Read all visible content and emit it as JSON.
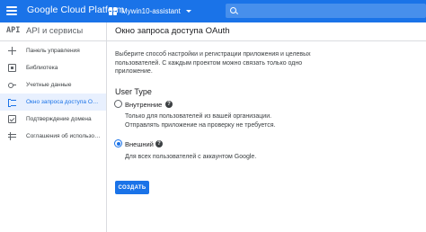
{
  "topbar": {
    "brand": "Google Cloud Platform",
    "project": "Mywin10-assistant",
    "accent_color": "#1a73e8"
  },
  "header": {
    "api_logo": "API",
    "api_title": "API и сервисы",
    "page_title": "Окно запроса доступа OAuth"
  },
  "sidebar": {
    "items": [
      {
        "label": "Панель управления",
        "icon": "dashboard-icon"
      },
      {
        "label": "Библиотека",
        "icon": "library-icon"
      },
      {
        "label": "Учетные данные",
        "icon": "key-icon"
      },
      {
        "label": "Окно запроса доступа OAuth",
        "icon": "consent-icon",
        "active": true
      },
      {
        "label": "Подтверждение домена",
        "icon": "checkbox-icon"
      },
      {
        "label": "Соглашения об использов...",
        "icon": "settings-icon"
      }
    ]
  },
  "main": {
    "description": "Выберите способ настройки и регистрации приложения и целевых пользователей. С каждым проектом можно связать только одно приложение.",
    "user_type_title": "User Type",
    "options": [
      {
        "label": "Внутренние",
        "description": "Только для пользователей из вашей организации. Отправлять приложение на проверку не требуется.",
        "selected": false
      },
      {
        "label": "Внешний",
        "description": "Для всех пользователей с аккаунтом Google.",
        "selected": true
      }
    ],
    "create_button": "СОЗДАТЬ"
  }
}
